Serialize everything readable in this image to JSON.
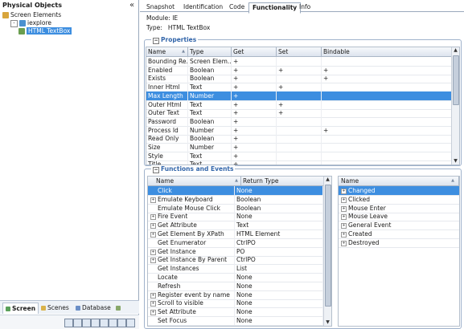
{
  "left": {
    "title": "Physical Objects",
    "tree": [
      {
        "label": "Screen Elements",
        "indent": 0,
        "twisty": ""
      },
      {
        "label": "iexplore",
        "indent": 1,
        "twisty": "-"
      },
      {
        "label": "HTML TextBox",
        "indent": 2,
        "twisty": "",
        "selected": true
      }
    ],
    "tabs": [
      "Screen",
      "Scenes",
      "Database"
    ]
  },
  "tabs": [
    "Snapshot",
    "Identification",
    "Code",
    "Functionality",
    "Info"
  ],
  "active_tab": "Functionality",
  "info": {
    "module_label": "Module:",
    "module_value": "IE",
    "type_label": "Type:",
    "type_value": "HTML TextBox"
  },
  "properties": {
    "title": "Properties",
    "columns": [
      "Name",
      "Type",
      "Get",
      "Set",
      "Bindable"
    ],
    "rows": [
      [
        "Bounding Re...",
        "Screen Elem...",
        "+",
        "",
        ""
      ],
      [
        "Enabled",
        "Boolean",
        "+",
        "+",
        "+"
      ],
      [
        "Exists",
        "Boolean",
        "+",
        "",
        "+"
      ],
      [
        "Inner Html",
        "Text",
        "+",
        "+",
        ""
      ],
      [
        "Max Length",
        "Number",
        "+",
        "",
        ""
      ],
      [
        "Outer Html",
        "Text",
        "+",
        "+",
        ""
      ],
      [
        "Outer Text",
        "Text",
        "+",
        "+",
        ""
      ],
      [
        "Password",
        "Boolean",
        "+",
        "",
        ""
      ],
      [
        "Process Id",
        "Number",
        "+",
        "",
        "+"
      ],
      [
        "Read Only",
        "Boolean",
        "+",
        "",
        ""
      ],
      [
        "Size",
        "Number",
        "+",
        "",
        ""
      ],
      [
        "Style",
        "Text",
        "+",
        "",
        ""
      ],
      [
        "Title",
        "Text",
        "+",
        "",
        ""
      ]
    ],
    "selected_row": 4
  },
  "functions": {
    "title": "Functions and Events",
    "columns": [
      "Name",
      "Return Type"
    ],
    "rows": [
      {
        "name": "Click",
        "ret": "None",
        "exp": false,
        "sel": true
      },
      {
        "name": "Emulate Keyboard",
        "ret": "Boolean",
        "exp": true
      },
      {
        "name": "Emulate Mouse Click",
        "ret": "Boolean",
        "exp": false
      },
      {
        "name": "Fire Event",
        "ret": "None",
        "exp": true
      },
      {
        "name": "Get Attribute",
        "ret": "Text",
        "exp": true
      },
      {
        "name": "Get Element By XPath",
        "ret": "HTML Element",
        "exp": true
      },
      {
        "name": "Get Enumerator",
        "ret": "CtrlPO",
        "exp": false
      },
      {
        "name": "Get Instance",
        "ret": "PO",
        "exp": true
      },
      {
        "name": "Get Instance By Parent",
        "ret": "CtrlPO",
        "exp": true
      },
      {
        "name": "Get Instances",
        "ret": "List",
        "exp": false
      },
      {
        "name": "Locate",
        "ret": "None",
        "exp": false
      },
      {
        "name": "Refresh",
        "ret": "None",
        "exp": false
      },
      {
        "name": "Register event by name",
        "ret": "None",
        "exp": true
      },
      {
        "name": "Scroll to visible",
        "ret": "None",
        "exp": true
      },
      {
        "name": "Set Attribute",
        "ret": "None",
        "exp": true
      },
      {
        "name": "Set Focus",
        "ret": "None",
        "exp": false
      }
    ]
  },
  "events": {
    "columns": [
      "Name"
    ],
    "rows": [
      {
        "name": "Changed",
        "sel": true
      },
      {
        "name": "Clicked"
      },
      {
        "name": "Mouse Enter"
      },
      {
        "name": "Mouse Leave"
      },
      {
        "name": "General Event"
      },
      {
        "name": "Created"
      },
      {
        "name": "Destroyed"
      }
    ]
  },
  "colors": {
    "selection": "#3d8ee0",
    "group_title": "#3366aa"
  }
}
